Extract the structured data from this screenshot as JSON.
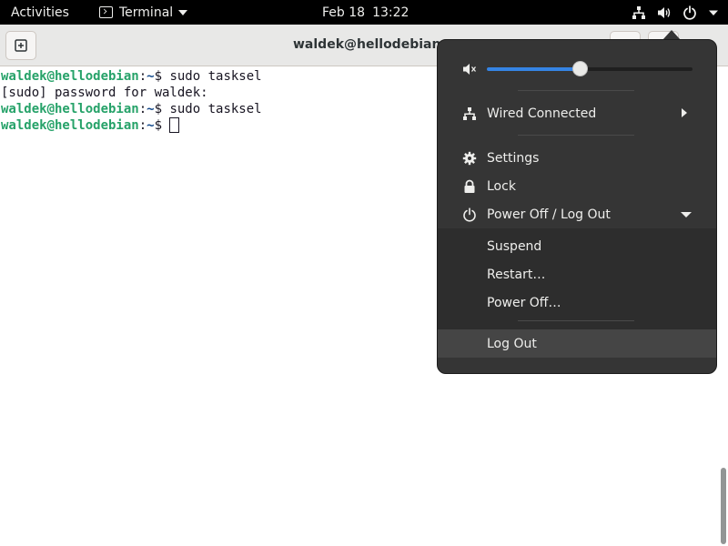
{
  "topbar": {
    "activities": "Activities",
    "app_name": "Terminal",
    "date": "Feb 18",
    "time": "13:22",
    "icons": [
      "network-wired-icon",
      "audio-volume-icon",
      "power-icon",
      "chevron-down-icon"
    ]
  },
  "window": {
    "title": "waldek@hellodebian: ~"
  },
  "terminal": {
    "lines": [
      {
        "user": "waldek@hellodebian",
        "path": "~",
        "cmd": "$ sudo tasksel"
      },
      {
        "text": "[sudo] password for waldek:"
      },
      {
        "user": "waldek@hellodebian",
        "path": "~",
        "cmd": "$ sudo tasksel"
      },
      {
        "user": "waldek@hellodebian",
        "path": "~",
        "cmd": "$ "
      }
    ],
    "colon": ":"
  },
  "system_menu": {
    "volume_level": 0.45,
    "network_label": "Wired Connected",
    "settings_label": "Settings",
    "lock_label": "Lock",
    "power_label": "Power Off / Log Out",
    "suspend_label": "Suspend",
    "restart_label": "Restart…",
    "poweroff_label": "Power Off…",
    "logout_label": "Log Out"
  },
  "colors": {
    "accent": "#3584e4",
    "prompt_user": "#26a269",
    "prompt_path": "#12488b",
    "menu_bg": "#353535"
  }
}
